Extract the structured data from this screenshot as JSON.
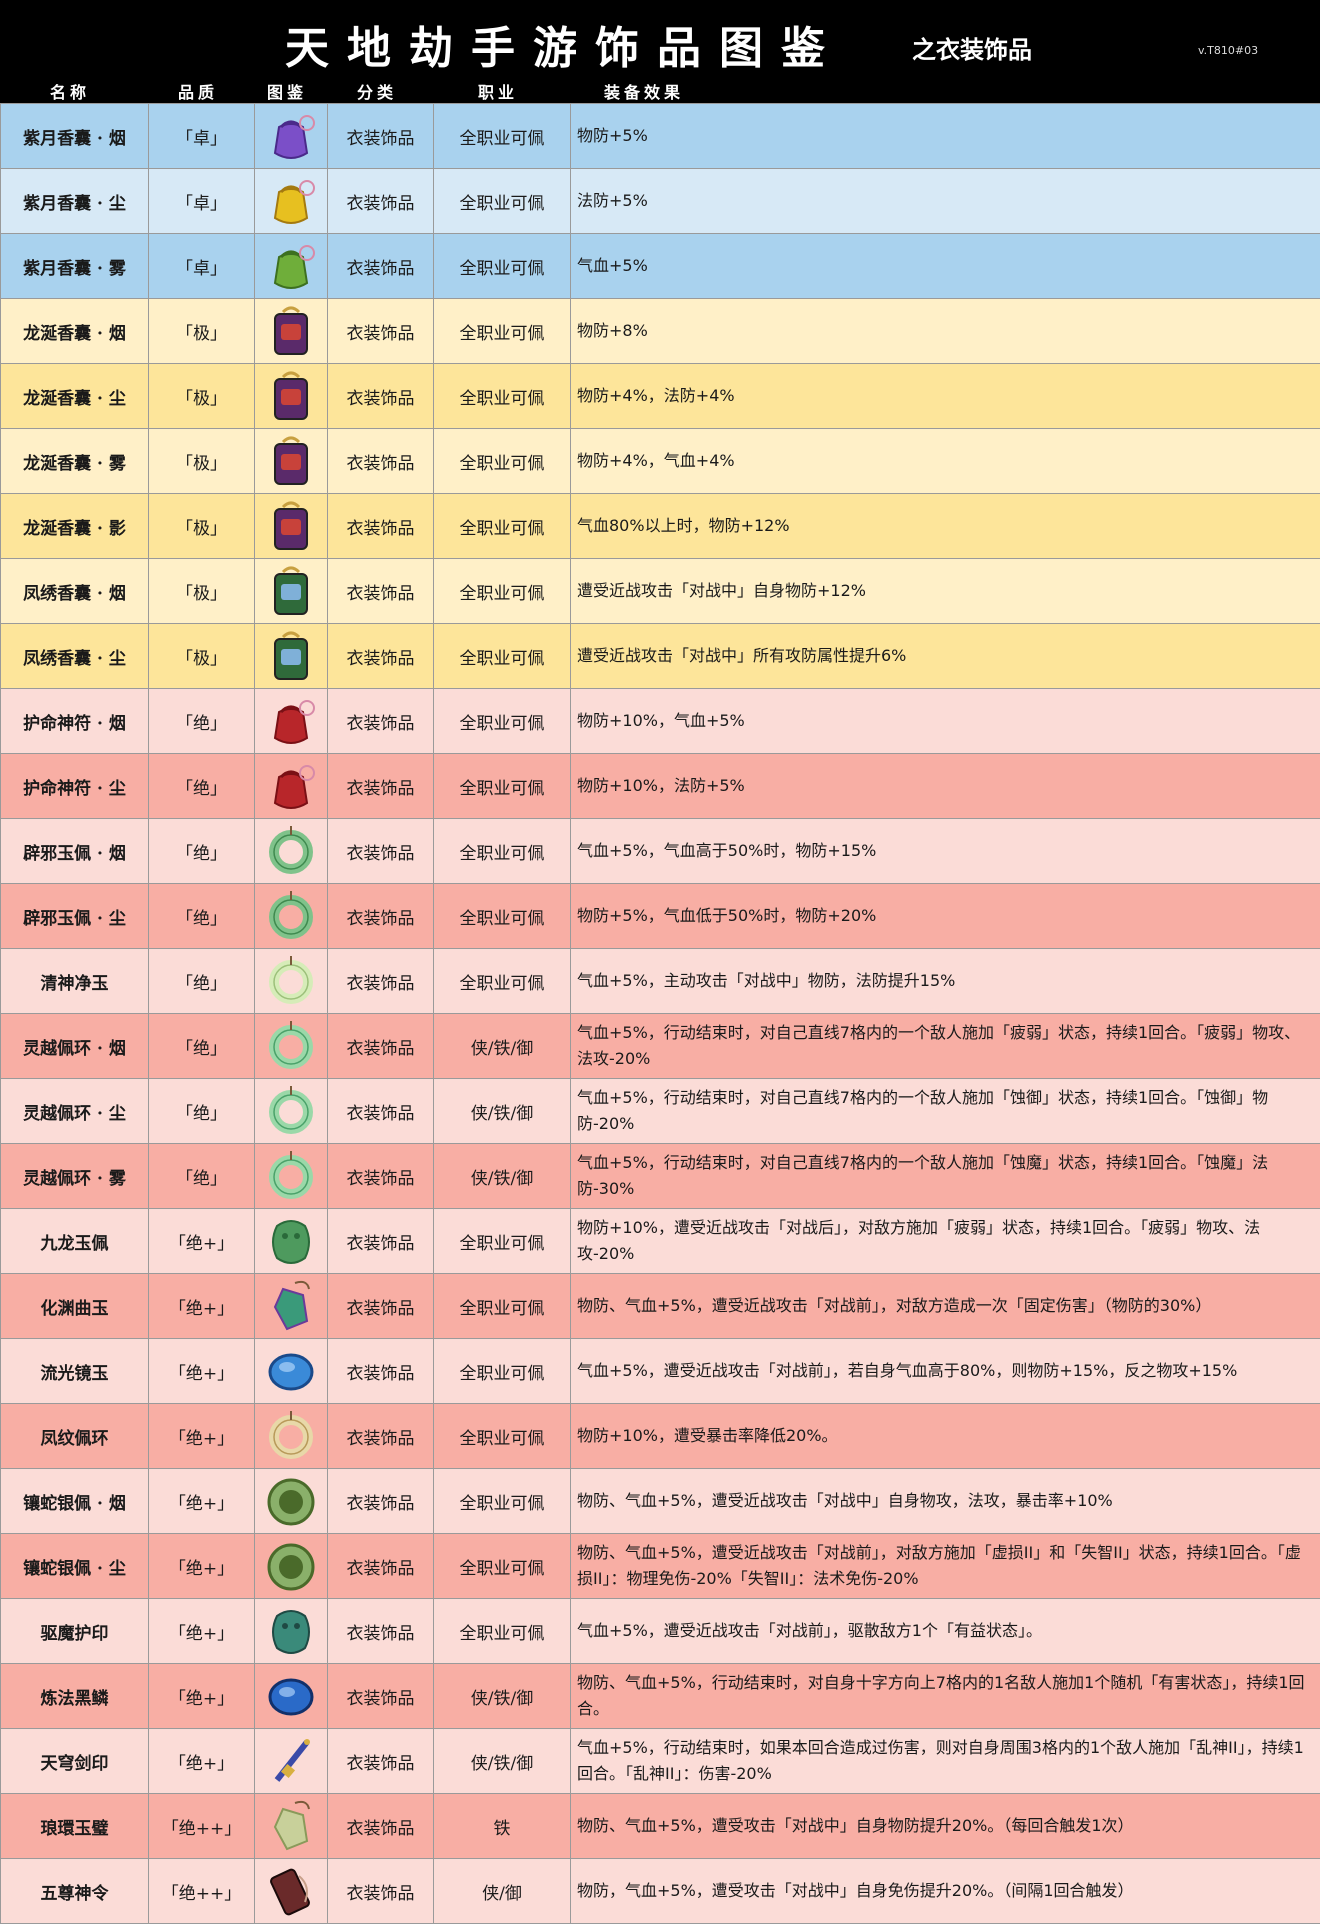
{
  "header": {
    "title": "天地劫手游饰品图鉴",
    "subtitle": "之衣装饰品",
    "version": "v.T810#03"
  },
  "columns": [
    "名称",
    "品质",
    "图鉴",
    "分类",
    "职业",
    "装备效果"
  ],
  "colors": {
    "blue_a": "#a9d2ee",
    "blue_b": "#d7e9f6",
    "yellow_a": "#fff0c8",
    "yellow_b": "#fde59a",
    "pink_a": "#fbdcd7",
    "pink_b": "#f8aea4"
  },
  "rows": [
    {
      "name": "紫月香囊 · 烟",
      "grade": "「卓」",
      "icon": "purple-sachet-icon",
      "cat": "衣装饰品",
      "job": "全职业可佩",
      "effect": "物防+5%",
      "bg": "#a9d2ee"
    },
    {
      "name": "紫月香囊 · 尘",
      "grade": "「卓」",
      "icon": "yellow-sachet-icon",
      "cat": "衣装饰品",
      "job": "全职业可佩",
      "effect": "法防+5%",
      "bg": "#d7e9f6"
    },
    {
      "name": "紫月香囊 · 雾",
      "grade": "「卓」",
      "icon": "green-sachet-icon",
      "cat": "衣装饰品",
      "job": "全职业可佩",
      "effect": "气血+5%",
      "bg": "#a9d2ee"
    },
    {
      "name": "龙涎香囊 · 烟",
      "grade": "「极」",
      "icon": "dragon-sachet-icon",
      "cat": "衣装饰品",
      "job": "全职业可佩",
      "effect": "物防+8%",
      "bg": "#fff0c8"
    },
    {
      "name": "龙涎香囊 · 尘",
      "grade": "「极」",
      "icon": "dragon-sachet-icon",
      "cat": "衣装饰品",
      "job": "全职业可佩",
      "effect": "物防+4%，法防+4%",
      "bg": "#fde59a"
    },
    {
      "name": "龙涎香囊 · 雾",
      "grade": "「极」",
      "icon": "dragon-sachet-icon",
      "cat": "衣装饰品",
      "job": "全职业可佩",
      "effect": "物防+4%，气血+4%",
      "bg": "#fff0c8"
    },
    {
      "name": "龙涎香囊 · 影",
      "grade": "「极」",
      "icon": "dragon-sachet-icon",
      "cat": "衣装饰品",
      "job": "全职业可佩",
      "effect": "气血80%以上时，物防+12%",
      "bg": "#fde59a"
    },
    {
      "name": "凤绣香囊 · 烟",
      "grade": "「极」",
      "icon": "phoenix-sachet-icon",
      "cat": "衣装饰品",
      "job": "全职业可佩",
      "effect": "遭受近战攻击「对战中」自身物防+12%",
      "bg": "#fff0c8"
    },
    {
      "name": "凤绣香囊 · 尘",
      "grade": "「极」",
      "icon": "phoenix-sachet-icon",
      "cat": "衣装饰品",
      "job": "全职业可佩",
      "effect": "遭受近战攻击「对战中」所有攻防属性提升6%",
      "bg": "#fde59a"
    },
    {
      "name": "护命神符 · 烟",
      "grade": "「绝」",
      "icon": "talisman-pouch-icon",
      "cat": "衣装饰品",
      "job": "全职业可佩",
      "effect": "物防+10%，气血+5%",
      "bg": "#fbdcd7"
    },
    {
      "name": "护命神符 · 尘",
      "grade": "「绝」",
      "icon": "talisman-pouch-icon",
      "cat": "衣装饰品",
      "job": "全职业可佩",
      "effect": "物防+10%，法防+5%",
      "bg": "#f8aea4"
    },
    {
      "name": "辟邪玉佩 · 烟",
      "grade": "「绝」",
      "icon": "jade-ring-icon",
      "cat": "衣装饰品",
      "job": "全职业可佩",
      "effect": "气血+5%，气血高于50%时，物防+15%",
      "bg": "#fbdcd7"
    },
    {
      "name": "辟邪玉佩 · 尘",
      "grade": "「绝」",
      "icon": "jade-ring-icon",
      "cat": "衣装饰品",
      "job": "全职业可佩",
      "effect": "物防+5%，气血低于50%时，物防+20%",
      "bg": "#f8aea4"
    },
    {
      "name": "清神净玉",
      "grade": "「绝」",
      "icon": "pale-jade-icon",
      "cat": "衣装饰品",
      "job": "全职业可佩",
      "effect": "气血+5%，主动攻击「对战中」物防，法防提升15%",
      "bg": "#fbdcd7"
    },
    {
      "name": "灵越佩环 · 烟",
      "grade": "「绝」",
      "icon": "jade-pendant-icon",
      "cat": "衣装饰品",
      "job": "侠/铁/御",
      "effect": "气血+5%，行动结束时，对自己直线7格内的一个敌人施加「疲弱」状态，持续1回合。「疲弱」物攻、法攻-20%",
      "bg": "#f8aea4"
    },
    {
      "name": "灵越佩环 · 尘",
      "grade": "「绝」",
      "icon": "jade-pendant-icon",
      "cat": "衣装饰品",
      "job": "侠/铁/御",
      "effect": "气血+5%，行动结束时，对自己直线7格内的一个敌人施加「蚀御」状态，持续1回合。「蚀御」物防-20%",
      "bg": "#fbdcd7"
    },
    {
      "name": "灵越佩环 · 雾",
      "grade": "「绝」",
      "icon": "jade-pendant-icon",
      "cat": "衣装饰品",
      "job": "侠/铁/御",
      "effect": "气血+5%，行动结束时，对自己直线7格内的一个敌人施加「蚀魔」状态，持续1回合。「蚀魔」法防-30%",
      "bg": "#f8aea4"
    },
    {
      "name": "九龙玉佩",
      "grade": "「绝+」",
      "icon": "nine-dragon-jade-icon",
      "cat": "衣装饰品",
      "job": "全职业可佩",
      "effect": "物防+10%，遭受近战攻击「对战后」，对敌方施加「疲弱」状态，持续1回合。「疲弱」物攻、法攻-20%",
      "bg": "#fbdcd7"
    },
    {
      "name": "化渊曲玉",
      "grade": "「绝+」",
      "icon": "curved-jade-icon",
      "cat": "衣装饰品",
      "job": "全职业可佩",
      "effect": "物防、气血+5%，遭受近战攻击「对战前」，对敌方造成一次「固定伤害」（物防的30%）",
      "bg": "#f8aea4"
    },
    {
      "name": "流光镜玉",
      "grade": "「绝+」",
      "icon": "mirror-jade-icon",
      "cat": "衣装饰品",
      "job": "全职业可佩",
      "effect": "气血+5%，遭受近战攻击「对战前」，若自身气血高于80%，则物防+15%，反之物攻+15%",
      "bg": "#fbdcd7"
    },
    {
      "name": "凤纹佩环",
      "grade": "「绝+」",
      "icon": "phoenix-ring-icon",
      "cat": "衣装饰品",
      "job": "全职业可佩",
      "effect": "物防+10%，遭受暴击率降低20%。",
      "bg": "#f8aea4"
    },
    {
      "name": "镶蛇银佩 · 烟",
      "grade": "「绝+」",
      "icon": "serpent-disc-icon",
      "cat": "衣装饰品",
      "job": "全职业可佩",
      "effect": "物防、气血+5%，遭受近战攻击「对战中」自身物攻，法攻，暴击率+10%",
      "bg": "#fbdcd7"
    },
    {
      "name": "镶蛇银佩 · 尘",
      "grade": "「绝+」",
      "icon": "serpent-disc-icon",
      "cat": "衣装饰品",
      "job": "全职业可佩",
      "effect": "物防、气血+5%，遭受近战攻击「对战前」，对敌方施加「虚损II」和「失智II」状态，持续1回合。「虚损II」：物理免伤-20%「失智II」：法术免伤-20%",
      "bg": "#f8aea4"
    },
    {
      "name": "驱魔护印",
      "grade": "「绝+」",
      "icon": "demon-seal-icon",
      "cat": "衣装饰品",
      "job": "全职业可佩",
      "effect": "气血+5%，遭受近战攻击「对战前」，驱散敌方1个「有益状态」。",
      "bg": "#fbdcd7"
    },
    {
      "name": "炼法黑鳞",
      "grade": "「绝+」",
      "icon": "black-scale-icon",
      "cat": "衣装饰品",
      "job": "侠/铁/御",
      "effect": "物防、气血+5%，行动结束时，对自身十字方向上7格内的1名敌人施加1个随机「有害状态」，持续1回合。",
      "bg": "#f8aea4"
    },
    {
      "name": "天穹剑印",
      "grade": "「绝+」",
      "icon": "sword-seal-icon",
      "cat": "衣装饰品",
      "job": "侠/铁/御",
      "effect": "气血+5%，行动结束时，如果本回合造成过伤害，则对自身周围3格内的1个敌人施加「乱神II」，持续1回合。「乱神II」：伤害-20%",
      "bg": "#fbdcd7"
    },
    {
      "name": "琅環玉璧",
      "grade": "「绝++」",
      "icon": "jade-tablet-icon",
      "cat": "衣装饰品",
      "job": "铁",
      "effect": "物防、气血+5%，遭受攻击「对战中」自身物防提升20%。（每回合触发1次）",
      "bg": "#f8aea4"
    },
    {
      "name": "五尊神令",
      "grade": "「绝++」",
      "icon": "divine-token-icon",
      "cat": "衣装饰品",
      "job": "侠/御",
      "effect": "物防，气血+5%，遭受攻击「对战中」自身免伤提升20%。（间隔1回合触发）",
      "bg": "#fbdcd7"
    }
  ]
}
